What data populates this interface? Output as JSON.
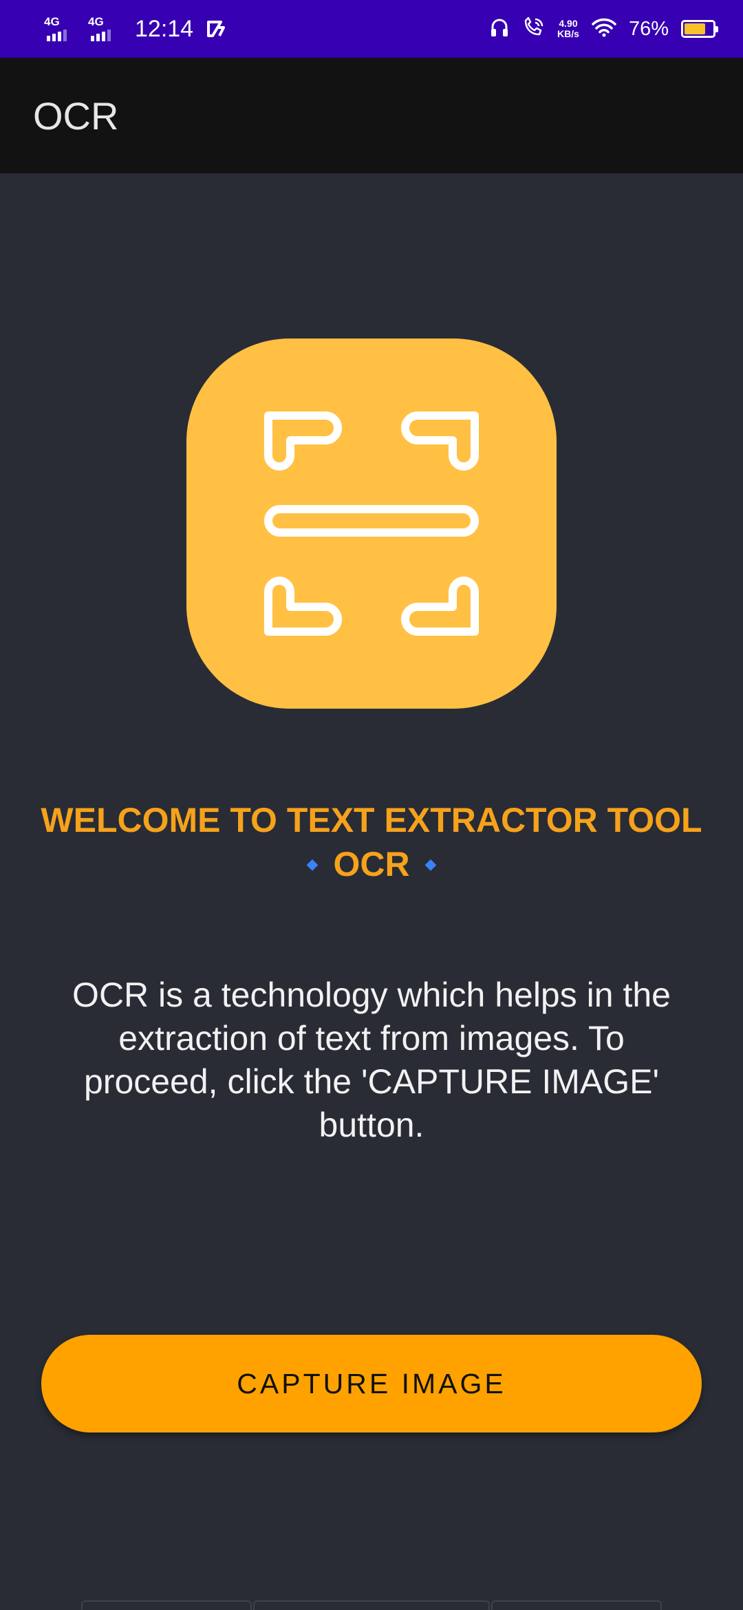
{
  "status_bar": {
    "network_1": "4G",
    "network_2": "4G",
    "time": "12:14",
    "speed_value": "4.90",
    "speed_unit": "KB/s",
    "battery_percent": "76%",
    "battery_level": 0.76,
    "battery_color": "#f7c12b",
    "icons": [
      "signal-icon",
      "cast-icon",
      "headphones-icon",
      "wifi-call-icon",
      "wifi-icon",
      "battery-icon"
    ]
  },
  "app_bar": {
    "title": "OCR"
  },
  "main": {
    "logo_icon": "scan-icon",
    "welcome_line1": "WELCOME TO TEXT EXTRACTOR TOOL",
    "welcome_line2": "OCR",
    "welcome_ornament": "◆",
    "description": "OCR is a technology which helps in the extraction of text from images. To proceed, click the 'CAPTURE IMAGE' button.",
    "capture_button": "CAPTURE IMAGE"
  },
  "colors": {
    "status_bar": "#3700b3",
    "app_bar": "#121212",
    "background": "#292c35",
    "accent": "#ffa200",
    "logo": "#ffc044",
    "title_text": "#f6a21b"
  }
}
